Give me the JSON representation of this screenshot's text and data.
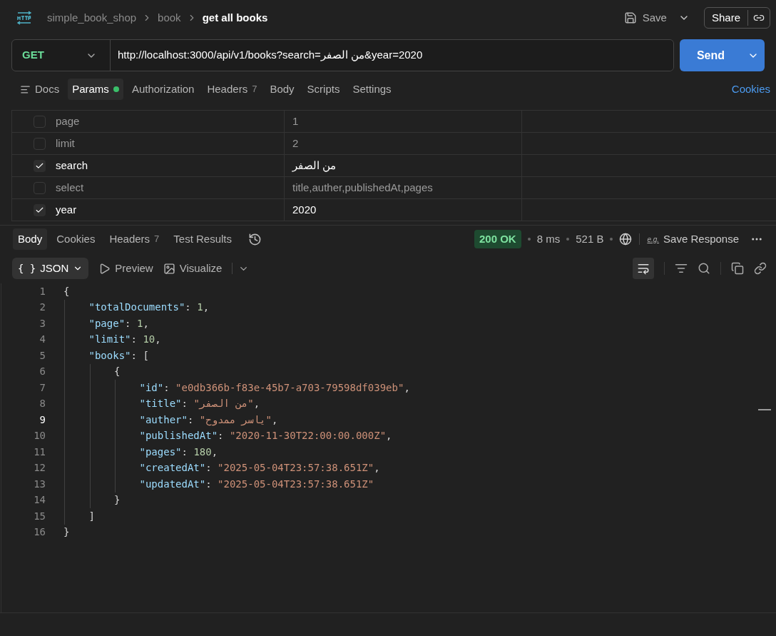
{
  "breadcrumb": {
    "items": [
      "simple_book_shop",
      "book"
    ],
    "current": "get all books"
  },
  "actions": {
    "save": "Save",
    "share": "Share"
  },
  "request": {
    "method": "GET",
    "url": "http://localhost:3000/api/v1/books?search=من الصفر&year=2020",
    "send": "Send"
  },
  "request_tabs": [
    {
      "label": "Docs",
      "selected": false,
      "indicator": false
    },
    {
      "label": "Params",
      "selected": true,
      "indicator": true
    },
    {
      "label": "Authorization",
      "selected": false,
      "indicator": false
    },
    {
      "label": "Headers",
      "count": "7",
      "selected": false,
      "indicator": false
    },
    {
      "label": "Body",
      "selected": false,
      "indicator": false
    },
    {
      "label": "Scripts",
      "selected": false,
      "indicator": false
    },
    {
      "label": "Settings",
      "selected": false,
      "indicator": false
    }
  ],
  "cookies_link": "Cookies",
  "params": [
    {
      "key": "page",
      "value": "1",
      "checked": false
    },
    {
      "key": "limit",
      "value": "2",
      "checked": false
    },
    {
      "key": "search",
      "value": "من الصفر",
      "checked": true
    },
    {
      "key": "select",
      "value": "title,auther,publishedAt,pages",
      "checked": false
    },
    {
      "key": "year",
      "value": "2020",
      "checked": true
    }
  ],
  "response_tabs": [
    {
      "label": "Body",
      "selected": true
    },
    {
      "label": "Cookies",
      "selected": false
    },
    {
      "label": "Headers",
      "count": "7",
      "selected": false
    },
    {
      "label": "Test Results",
      "selected": false
    }
  ],
  "status": {
    "code": "200 OK",
    "time": "8 ms",
    "size": "521 B",
    "save_response_icon": "e.g.",
    "save_response": "Save Response"
  },
  "body_toolbar": {
    "braces": "{ }",
    "format": "JSON",
    "preview": "Preview",
    "visualize": "Visualize"
  },
  "code_lines": [
    {
      "number": "1",
      "current": false,
      "tokens": [
        {
          "kind": "open",
          "text": "{"
        }
      ]
    },
    {
      "number": "2",
      "current": false,
      "tokens": [
        {
          "kind": "key",
          "text": "\"totalDocuments\""
        },
        {
          "kind": "punct",
          "text": ": "
        },
        {
          "kind": "num",
          "text": "1"
        },
        {
          "kind": "punct",
          "text": ","
        }
      ]
    },
    {
      "number": "3",
      "current": false,
      "tokens": [
        {
          "kind": "key",
          "text": "\"page\""
        },
        {
          "kind": "punct",
          "text": ": "
        },
        {
          "kind": "num",
          "text": "1"
        },
        {
          "kind": "punct",
          "text": ","
        }
      ]
    },
    {
      "number": "4",
      "current": false,
      "tokens": [
        {
          "kind": "key",
          "text": "\"limit\""
        },
        {
          "kind": "punct",
          "text": ": "
        },
        {
          "kind": "num",
          "text": "10"
        },
        {
          "kind": "punct",
          "text": ","
        }
      ]
    },
    {
      "number": "5",
      "current": false,
      "tokens": [
        {
          "kind": "key",
          "text": "\"books\""
        },
        {
          "kind": "punct",
          "text": ": "
        },
        {
          "kind": "open",
          "text": "["
        }
      ]
    },
    {
      "number": "6",
      "current": false,
      "tokens": [
        {
          "kind": "open",
          "text": "{"
        }
      ]
    },
    {
      "number": "7",
      "current": false,
      "tokens": [
        {
          "kind": "key",
          "text": "\"id\""
        },
        {
          "kind": "punct",
          "text": ": "
        },
        {
          "kind": "str",
          "text": "\"e0db366b-f83e-45b7-a703-79598df039eb\""
        },
        {
          "kind": "punct",
          "text": ","
        }
      ]
    },
    {
      "number": "8",
      "current": false,
      "tokens": [
        {
          "kind": "key",
          "text": "\"title\""
        },
        {
          "kind": "punct",
          "text": ": "
        },
        {
          "kind": "str",
          "text": "\"من الصفر\""
        },
        {
          "kind": "punct",
          "text": ","
        }
      ]
    },
    {
      "number": "9",
      "current": true,
      "tokens": [
        {
          "kind": "key",
          "text": "\"auther\""
        },
        {
          "kind": "punct",
          "text": ": "
        },
        {
          "kind": "str",
          "text": "\"ياسر ممدوح\""
        },
        {
          "kind": "punct",
          "text": ","
        }
      ]
    },
    {
      "number": "10",
      "current": false,
      "tokens": [
        {
          "kind": "key",
          "text": "\"publishedAt\""
        },
        {
          "kind": "punct",
          "text": ": "
        },
        {
          "kind": "str",
          "text": "\"2020-11-30T22:00:00.000Z\""
        },
        {
          "kind": "punct",
          "text": ","
        }
      ]
    },
    {
      "number": "11",
      "current": false,
      "tokens": [
        {
          "kind": "key",
          "text": "\"pages\""
        },
        {
          "kind": "punct",
          "text": ": "
        },
        {
          "kind": "num",
          "text": "180"
        },
        {
          "kind": "punct",
          "text": ","
        }
      ]
    },
    {
      "number": "12",
      "current": false,
      "tokens": [
        {
          "kind": "key",
          "text": "\"createdAt\""
        },
        {
          "kind": "punct",
          "text": ": "
        },
        {
          "kind": "str",
          "text": "\"2025-05-04T23:57:38.651Z\""
        },
        {
          "kind": "punct",
          "text": ","
        }
      ]
    },
    {
      "number": "13",
      "current": false,
      "tokens": [
        {
          "kind": "key",
          "text": "\"updatedAt\""
        },
        {
          "kind": "punct",
          "text": ": "
        },
        {
          "kind": "str",
          "text": "\"2025-05-04T23:57:38.651Z\""
        }
      ]
    },
    {
      "number": "14",
      "current": false,
      "tokens": [
        {
          "kind": "close",
          "text": "}"
        }
      ]
    },
    {
      "number": "15",
      "current": false,
      "tokens": [
        {
          "kind": "close",
          "text": "]"
        }
      ]
    },
    {
      "number": "16",
      "current": false,
      "tokens": [
        {
          "kind": "close",
          "text": "}"
        }
      ]
    }
  ]
}
